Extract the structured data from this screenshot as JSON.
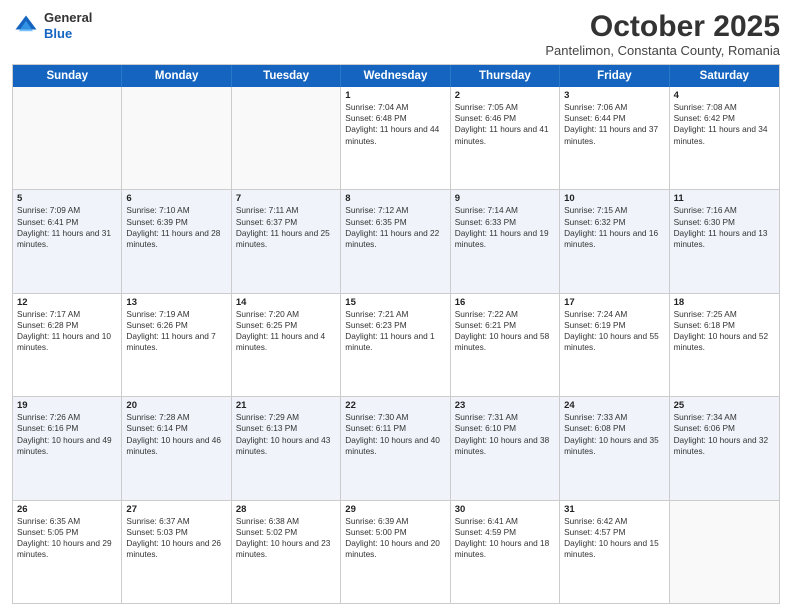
{
  "header": {
    "logo_general": "General",
    "logo_blue": "Blue",
    "month_title": "October 2025",
    "subtitle": "Pantelimon, Constanta County, Romania"
  },
  "calendar": {
    "days": [
      "Sunday",
      "Monday",
      "Tuesday",
      "Wednesday",
      "Thursday",
      "Friday",
      "Saturday"
    ],
    "rows": [
      [
        {
          "day": "",
          "info": "",
          "empty": true
        },
        {
          "day": "",
          "info": "",
          "empty": true
        },
        {
          "day": "",
          "info": "",
          "empty": true
        },
        {
          "day": "1",
          "info": "Sunrise: 7:04 AM\nSunset: 6:48 PM\nDaylight: 11 hours and 44 minutes.",
          "empty": false
        },
        {
          "day": "2",
          "info": "Sunrise: 7:05 AM\nSunset: 6:46 PM\nDaylight: 11 hours and 41 minutes.",
          "empty": false
        },
        {
          "day": "3",
          "info": "Sunrise: 7:06 AM\nSunset: 6:44 PM\nDaylight: 11 hours and 37 minutes.",
          "empty": false
        },
        {
          "day": "4",
          "info": "Sunrise: 7:08 AM\nSunset: 6:42 PM\nDaylight: 11 hours and 34 minutes.",
          "empty": false
        }
      ],
      [
        {
          "day": "5",
          "info": "Sunrise: 7:09 AM\nSunset: 6:41 PM\nDaylight: 11 hours and 31 minutes.",
          "empty": false
        },
        {
          "day": "6",
          "info": "Sunrise: 7:10 AM\nSunset: 6:39 PM\nDaylight: 11 hours and 28 minutes.",
          "empty": false
        },
        {
          "day": "7",
          "info": "Sunrise: 7:11 AM\nSunset: 6:37 PM\nDaylight: 11 hours and 25 minutes.",
          "empty": false
        },
        {
          "day": "8",
          "info": "Sunrise: 7:12 AM\nSunset: 6:35 PM\nDaylight: 11 hours and 22 minutes.",
          "empty": false
        },
        {
          "day": "9",
          "info": "Sunrise: 7:14 AM\nSunset: 6:33 PM\nDaylight: 11 hours and 19 minutes.",
          "empty": false
        },
        {
          "day": "10",
          "info": "Sunrise: 7:15 AM\nSunset: 6:32 PM\nDaylight: 11 hours and 16 minutes.",
          "empty": false
        },
        {
          "day": "11",
          "info": "Sunrise: 7:16 AM\nSunset: 6:30 PM\nDaylight: 11 hours and 13 minutes.",
          "empty": false
        }
      ],
      [
        {
          "day": "12",
          "info": "Sunrise: 7:17 AM\nSunset: 6:28 PM\nDaylight: 11 hours and 10 minutes.",
          "empty": false
        },
        {
          "day": "13",
          "info": "Sunrise: 7:19 AM\nSunset: 6:26 PM\nDaylight: 11 hours and 7 minutes.",
          "empty": false
        },
        {
          "day": "14",
          "info": "Sunrise: 7:20 AM\nSunset: 6:25 PM\nDaylight: 11 hours and 4 minutes.",
          "empty": false
        },
        {
          "day": "15",
          "info": "Sunrise: 7:21 AM\nSunset: 6:23 PM\nDaylight: 11 hours and 1 minute.",
          "empty": false
        },
        {
          "day": "16",
          "info": "Sunrise: 7:22 AM\nSunset: 6:21 PM\nDaylight: 10 hours and 58 minutes.",
          "empty": false
        },
        {
          "day": "17",
          "info": "Sunrise: 7:24 AM\nSunset: 6:19 PM\nDaylight: 10 hours and 55 minutes.",
          "empty": false
        },
        {
          "day": "18",
          "info": "Sunrise: 7:25 AM\nSunset: 6:18 PM\nDaylight: 10 hours and 52 minutes.",
          "empty": false
        }
      ],
      [
        {
          "day": "19",
          "info": "Sunrise: 7:26 AM\nSunset: 6:16 PM\nDaylight: 10 hours and 49 minutes.",
          "empty": false
        },
        {
          "day": "20",
          "info": "Sunrise: 7:28 AM\nSunset: 6:14 PM\nDaylight: 10 hours and 46 minutes.",
          "empty": false
        },
        {
          "day": "21",
          "info": "Sunrise: 7:29 AM\nSunset: 6:13 PM\nDaylight: 10 hours and 43 minutes.",
          "empty": false
        },
        {
          "day": "22",
          "info": "Sunrise: 7:30 AM\nSunset: 6:11 PM\nDaylight: 10 hours and 40 minutes.",
          "empty": false
        },
        {
          "day": "23",
          "info": "Sunrise: 7:31 AM\nSunset: 6:10 PM\nDaylight: 10 hours and 38 minutes.",
          "empty": false
        },
        {
          "day": "24",
          "info": "Sunrise: 7:33 AM\nSunset: 6:08 PM\nDaylight: 10 hours and 35 minutes.",
          "empty": false
        },
        {
          "day": "25",
          "info": "Sunrise: 7:34 AM\nSunset: 6:06 PM\nDaylight: 10 hours and 32 minutes.",
          "empty": false
        }
      ],
      [
        {
          "day": "26",
          "info": "Sunrise: 6:35 AM\nSunset: 5:05 PM\nDaylight: 10 hours and 29 minutes.",
          "empty": false
        },
        {
          "day": "27",
          "info": "Sunrise: 6:37 AM\nSunset: 5:03 PM\nDaylight: 10 hours and 26 minutes.",
          "empty": false
        },
        {
          "day": "28",
          "info": "Sunrise: 6:38 AM\nSunset: 5:02 PM\nDaylight: 10 hours and 23 minutes.",
          "empty": false
        },
        {
          "day": "29",
          "info": "Sunrise: 6:39 AM\nSunset: 5:00 PM\nDaylight: 10 hours and 20 minutes.",
          "empty": false
        },
        {
          "day": "30",
          "info": "Sunrise: 6:41 AM\nSunset: 4:59 PM\nDaylight: 10 hours and 18 minutes.",
          "empty": false
        },
        {
          "day": "31",
          "info": "Sunrise: 6:42 AM\nSunset: 4:57 PM\nDaylight: 10 hours and 15 minutes.",
          "empty": false
        },
        {
          "day": "",
          "info": "",
          "empty": true
        }
      ]
    ]
  }
}
